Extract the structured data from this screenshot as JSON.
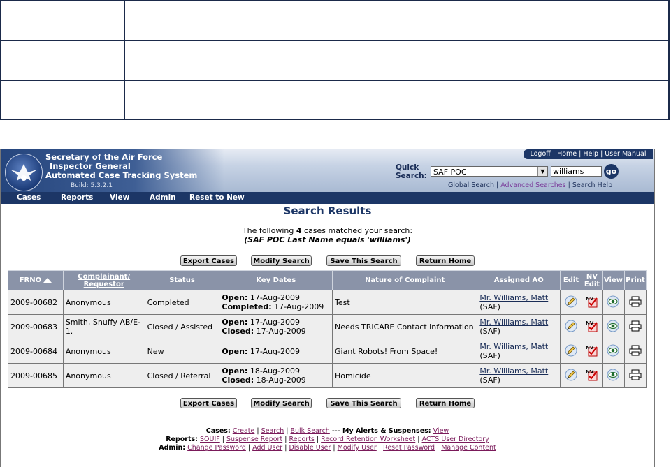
{
  "header": {
    "org_line1": "Secretary of the Air Force",
    "org_line2": "Inspector General",
    "org_line3": "Automated Case Tracking System",
    "build": "Build: 5.3.2.1",
    "top_links": [
      "Logoff",
      "Home",
      "Help",
      "User Manual"
    ],
    "quick_search_label": "Quick Search:",
    "quick_search_select": "SAF POC",
    "quick_search_value": "williams",
    "go_label": "go",
    "search_links": [
      "Global Search",
      "Advanced Searches",
      "Search Help"
    ]
  },
  "nav": [
    "Cases",
    "Reports",
    "View",
    "Admin",
    "Reset to New"
  ],
  "main": {
    "title": "Search Results",
    "summary_prefix": "The following",
    "summary_count": "4",
    "summary_suffix": "cases matched your search:",
    "criteria": "(SAF POC Last Name equals 'williams')",
    "buttons": [
      "Export Cases",
      "Modify Search",
      "Save This Search",
      "Return Home"
    ]
  },
  "table": {
    "headers": {
      "frno": "FRNO",
      "complainant": "Complainant/ Requestor",
      "status": "Status",
      "key_dates": "Key Dates",
      "nature": "Nature of Complaint",
      "assigned_ao": "Assigned AO",
      "edit": "Edit",
      "nv_edit": "NV Edit",
      "view": "View",
      "print": "Print"
    },
    "rows": [
      {
        "frno": "2009-00682",
        "complainant": "Anonymous",
        "status": "Completed",
        "date1_label": "Open:",
        "date1": "17-Aug-2009",
        "date2_label": "Completed:",
        "date2": "17-Aug-2009",
        "nature": "Test",
        "ao_name": "Mr. Williams, Matt",
        "ao_org": "(SAF)"
      },
      {
        "frno": "2009-00683",
        "complainant": "Smith, Snuffy AB/E-1.",
        "status": "Closed / Assisted",
        "date1_label": "Open:",
        "date1": "17-Aug-2009",
        "date2_label": "Closed:",
        "date2": "17-Aug-2009",
        "nature": "Needs TRICARE Contact information",
        "ao_name": "Mr. Williams, Matt",
        "ao_org": "(SAF)"
      },
      {
        "frno": "2009-00684",
        "complainant": "Anonymous",
        "status": "New",
        "date1_label": "Open:",
        "date1": "17-Aug-2009",
        "date2_label": "",
        "date2": "",
        "nature": "Giant Robots! From Space!",
        "ao_name": "Mr. Williams, Matt",
        "ao_org": "(SAF)"
      },
      {
        "frno": "2009-00685",
        "complainant": "Anonymous",
        "status": "Closed / Referral",
        "date1_label": "Open:",
        "date1": "18-Aug-2009",
        "date2_label": "Closed:",
        "date2": "18-Aug-2009",
        "nature": "Homicide",
        "ao_name": "Mr. Williams, Matt",
        "ao_org": "(SAF)"
      }
    ],
    "nv_icon_text": "NV"
  },
  "footer": {
    "cases_label": "Cases:",
    "cases_links": [
      "Create",
      "Search",
      "Bulk Search"
    ],
    "alerts_label": "--- My Alerts & Suspenses:",
    "alerts_link": "View",
    "reports_label": "Reports:",
    "reports_links": [
      "SOUIF",
      "Suspense Report",
      "Reports",
      "Record Retention Worksheet",
      "ACTS User Directory"
    ],
    "admin_label": "Admin:",
    "admin_links": [
      "Change Password",
      "Add User",
      "Disable User",
      "Modify User",
      "Reset Password",
      "Manage Content"
    ]
  }
}
